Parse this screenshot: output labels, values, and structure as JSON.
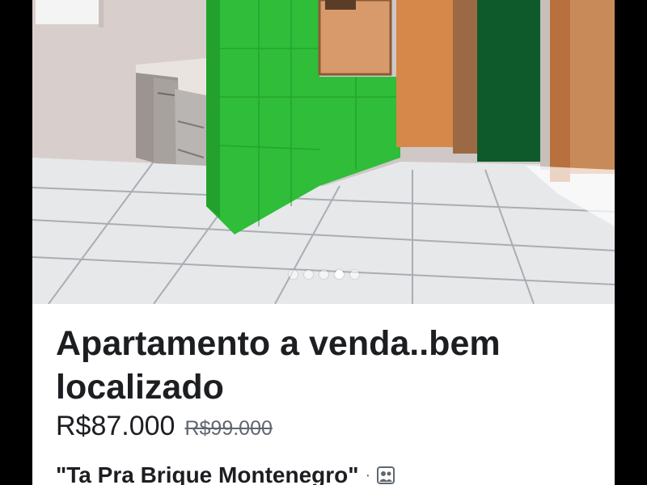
{
  "listing": {
    "photo": {
      "icon": "apartment-photo",
      "slides_total": 5,
      "active_slide": 4
    },
    "title": "Apartamento a venda..bem localizado",
    "price": "R$87.000",
    "original_price": "R$99.000",
    "seller": "\"Ta Pra Brique Montenegro\"",
    "separator": "·",
    "seller_icon": "group-icon"
  }
}
